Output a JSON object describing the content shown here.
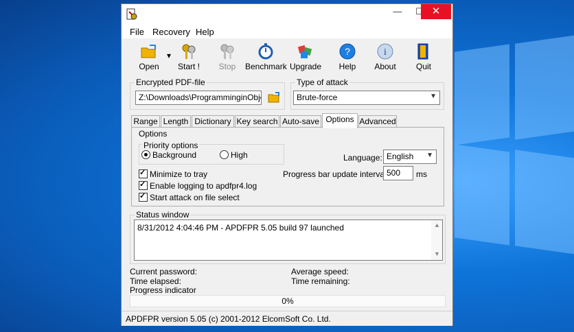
{
  "window": {
    "title": ""
  },
  "menu": {
    "file": "File",
    "recovery": "Recovery",
    "help": "Help"
  },
  "toolbar": {
    "open": "Open",
    "start": "Start !",
    "stop": "Stop",
    "benchmark": "Benchmark",
    "upgrade": "Upgrade",
    "help": "Help",
    "about": "About",
    "quit": "Quit"
  },
  "encrypted_file": {
    "label": "Encrypted PDF-file",
    "value": "Z:\\Downloads\\ProgramminginObject"
  },
  "attack": {
    "label": "Type of attack",
    "value": "Brute-force"
  },
  "tabs": [
    "Range",
    "Length",
    "Dictionary",
    "Key search",
    "Auto-save",
    "Options",
    "Advanced"
  ],
  "options": {
    "group_label": "Options",
    "priority_label": "Priority options",
    "background": "Background",
    "high": "High",
    "priority_selected": "Background",
    "language_label": "Language:",
    "language_value": "English",
    "minimize": "Minimize to tray",
    "logging": "Enable logging to apdfpr4.log",
    "start_attack": "Start attack on file select",
    "interval_label": "Progress bar update interval",
    "interval_value": "500",
    "interval_unit": "ms"
  },
  "status": {
    "label": "Status window",
    "log": "8/31/2012 4:04:46 PM - APDFPR 5.05 build 97 launched"
  },
  "info": {
    "current_password": "Current password:",
    "time_elapsed": "Time elapsed:",
    "progress_indicator": "Progress indicator",
    "average_speed": "Average speed:",
    "time_remaining": "Time remaining:"
  },
  "progress": {
    "text": "0%",
    "value": 0
  },
  "statusbar": {
    "text": "APDFPR version 5.05 (c) 2001-2012 ElcomSoft Co. Ltd."
  },
  "colors": {
    "close": "#e81123",
    "accent": "#0078d7"
  }
}
